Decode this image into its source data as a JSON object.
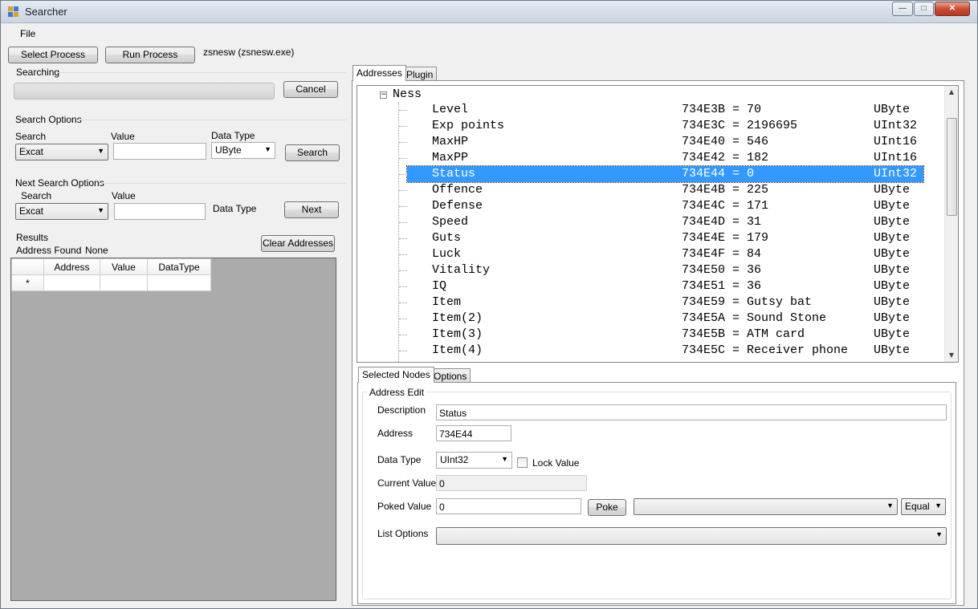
{
  "window": {
    "title": "Searcher",
    "min": "—",
    "max": "□",
    "close": "✕"
  },
  "menu": {
    "file": "File"
  },
  "toolbar": {
    "select_process": "Select Process",
    "run_process": "Run Process",
    "process_name": "zsnesw (zsnesw.exe)"
  },
  "searching": {
    "label": "Searching",
    "cancel": "Cancel",
    "progress": 0
  },
  "search_options": {
    "label": "Search Options",
    "search_label": "Search",
    "search_value": "Excat",
    "value_label": "Value",
    "value": "",
    "data_type_label": "Data Type",
    "data_type": "UByte",
    "search_button": "Search"
  },
  "next_search_options": {
    "label": "Next Search Options",
    "search_label": "Search",
    "search_value": "Excat",
    "value_label": "Value",
    "value": "",
    "data_type_label": "Data Type",
    "next_button": "Next"
  },
  "results": {
    "label": "Results",
    "address_found_label": "Address Found",
    "address_found_value": "None",
    "clear_button": "Clear Addresses",
    "columns": [
      "Address",
      "Value",
      "DataType"
    ],
    "new_row_marker": "*"
  },
  "top_tabs": [
    "Addresses",
    "Plugin"
  ],
  "tree": {
    "root": "Ness",
    "rows": [
      {
        "name": "Level",
        "address": "734E3B = 70",
        "type": "UByte"
      },
      {
        "name": "Exp points",
        "address": "734E3C = 2196695",
        "type": "UInt32"
      },
      {
        "name": "MaxHP",
        "address": "734E40 = 546",
        "type": "UInt16"
      },
      {
        "name": "MaxPP",
        "address": "734E42 = 182",
        "type": "UInt16"
      },
      {
        "name": "Status",
        "address": "734E44 = 0",
        "type": "UInt32"
      },
      {
        "name": "Offence",
        "address": "734E4B = 225",
        "type": "UByte"
      },
      {
        "name": "Defense",
        "address": "734E4C = 171",
        "type": "UByte"
      },
      {
        "name": "Speed",
        "address": "734E4D = 31",
        "type": "UByte"
      },
      {
        "name": "Guts",
        "address": "734E4E = 179",
        "type": "UByte"
      },
      {
        "name": "Luck",
        "address": "734E4F = 84",
        "type": "UByte"
      },
      {
        "name": "Vitality",
        "address": "734E50 = 36",
        "type": "UByte"
      },
      {
        "name": "IQ",
        "address": "734E51 = 36",
        "type": "UByte"
      },
      {
        "name": "Item",
        "address": "734E59 = Gutsy bat",
        "type": "UByte"
      },
      {
        "name": "Item(2)",
        "address": "734E5A = Sound Stone",
        "type": "UByte"
      },
      {
        "name": "Item(3)",
        "address": "734E5B = ATM card",
        "type": "UByte"
      },
      {
        "name": "Item(4)",
        "address": "734E5C = Receiver phone",
        "type": "UByte"
      }
    ],
    "selected_index": 4
  },
  "bottom_tabs": [
    "Selected Nodes",
    "Options"
  ],
  "address_edit": {
    "group_label": "Address Edit",
    "description_label": "Description",
    "description": "Status",
    "address_label": "Address",
    "address": "734E44",
    "data_type_label": "Data Type",
    "data_type": "UInt32",
    "lock_label": "Lock Value",
    "current_value_label": "Current Value",
    "current_value": "0",
    "poked_value_label": "Poked Value",
    "poked_value": "0",
    "poke_button": "Poke",
    "compare": "Equal",
    "compare_target": "",
    "list_options_label": "List Options",
    "list_options": ""
  }
}
